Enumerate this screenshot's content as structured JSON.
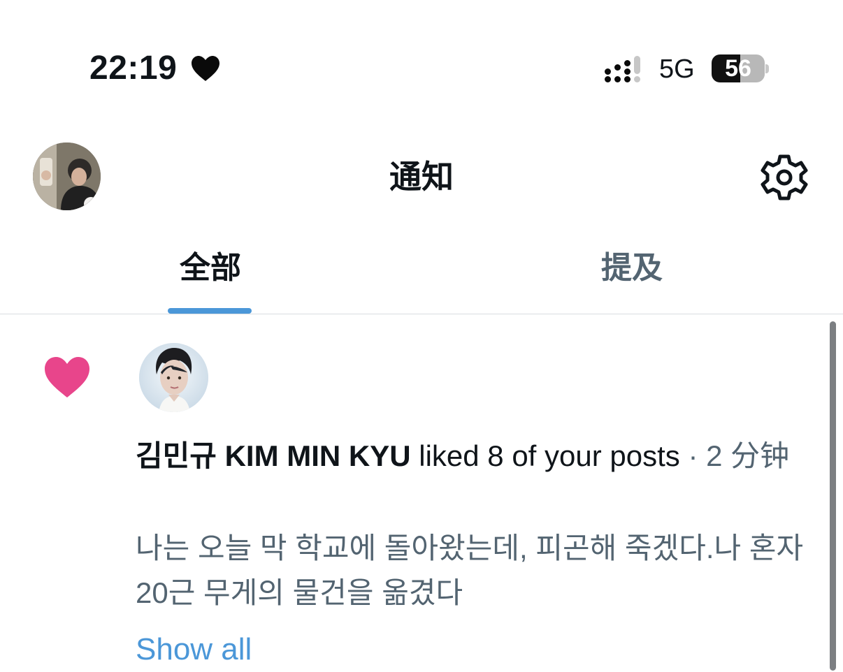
{
  "status_bar": {
    "time": "22:19",
    "heart_icon": "heart-icon",
    "signal_icon": "cellular-signal-icon",
    "network": "5G",
    "battery": "56",
    "battery_icon": "battery-icon"
  },
  "header": {
    "avatar_icon": "profile-avatar",
    "title": "通知",
    "settings_icon": "gear-icon"
  },
  "tabs": [
    {
      "label": "全部",
      "selected": true
    },
    {
      "label": "提及",
      "selected": false
    }
  ],
  "colors": {
    "accent": "#4b97d8",
    "like": "#e8458b",
    "secondary_text": "#536471",
    "primary_text": "#0f1419"
  },
  "notification": {
    "icon": "heart-icon",
    "avatar": "user-avatar",
    "user": "김민규 KIM MIN KYU",
    "action": "liked 8 of your posts",
    "time": "· 2 分钟",
    "post_text": "나는 오늘 막 학교에 돌아왔는데, 피곤해 죽겠다.나 혼자 20근 무게의 물건을 옮겼다",
    "show_all": "Show all"
  }
}
